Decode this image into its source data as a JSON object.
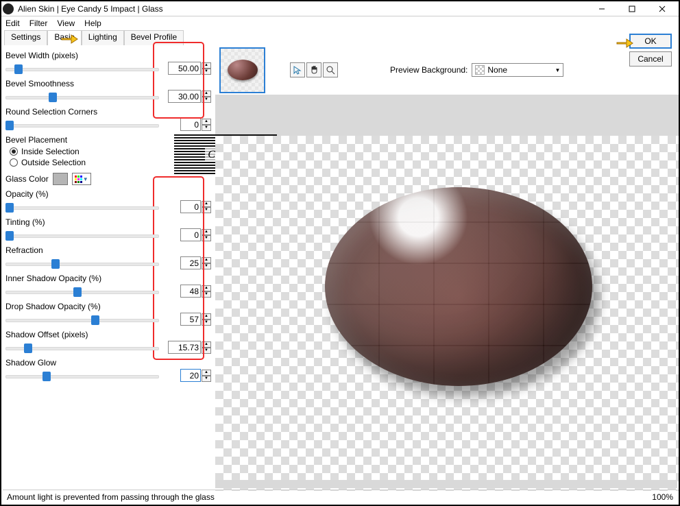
{
  "window": {
    "title": "Alien Skin | Eye Candy 5 Impact | Glass"
  },
  "menu": {
    "edit": "Edit",
    "filter": "Filter",
    "view": "View",
    "help": "Help"
  },
  "tabs": {
    "settings": "Settings",
    "basic": "Basic",
    "lighting": "Lighting",
    "bevel": "Bevel Profile"
  },
  "sliders": {
    "bevel_width": {
      "label": "Bevel Width (pixels)",
      "value": "50.00",
      "pos": 6
    },
    "bevel_smoothness": {
      "label": "Bevel Smoothness",
      "value": "30.00",
      "pos": 28
    },
    "round_corners": {
      "label": "Round Selection Corners",
      "value": "0",
      "pos": 0
    },
    "opacity": {
      "label": "Opacity (%)",
      "value": "0",
      "pos": 0
    },
    "tinting": {
      "label": "Tinting (%)",
      "value": "0",
      "pos": 0
    },
    "refraction": {
      "label": "Refraction",
      "value": "25",
      "pos": 30
    },
    "inner_shadow": {
      "label": "Inner Shadow Opacity (%)",
      "value": "48",
      "pos": 44
    },
    "drop_shadow": {
      "label": "Drop Shadow Opacity (%)",
      "value": "57",
      "pos": 56
    },
    "shadow_offset": {
      "label": "Shadow Offset (pixels)",
      "value": "15.73",
      "pos": 12
    },
    "shadow_glow": {
      "label": "Shadow Glow",
      "value": "20",
      "pos": 24
    }
  },
  "placement": {
    "label": "Bevel Placement",
    "inside": "Inside Selection",
    "outside": "Outside Selection"
  },
  "glass_color_label": "Glass Color",
  "preview_bg": {
    "label": "Preview Background:",
    "value": "None"
  },
  "buttons": {
    "ok": "OK",
    "cancel": "Cancel"
  },
  "status": {
    "text": "Amount light is prevented from passing through the glass",
    "zoom": "100%"
  },
  "watermark": "Claudia"
}
